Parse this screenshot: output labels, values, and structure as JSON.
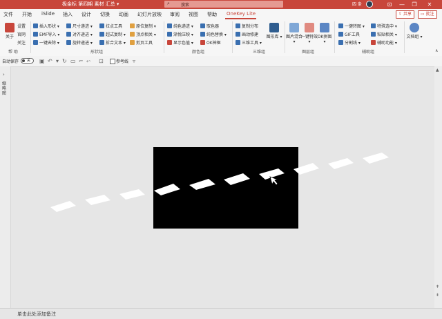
{
  "titlebar": {
    "doc_title": "极金标 第四期 素材 汇总 ▾",
    "search_icon": "search-icon",
    "search_placeholder": "搜索",
    "user_name": "四 条",
    "minimize": "—",
    "restore": "❐",
    "close": "✕",
    "ribbon_toggle": "⊡"
  },
  "tabs": [
    "文件",
    "开始",
    "iSlide",
    "插入",
    "设计",
    "切换",
    "动画",
    "幻灯片放映",
    "审阅",
    "视图",
    "帮助",
    "OneKey Lite"
  ],
  "active_tab": "OneKey Lite",
  "share_label": "共享",
  "comment_label": "批注",
  "ribbon": {
    "group1": {
      "about": "关于",
      "settings": "设置",
      "website": "官网",
      "follow": "关注",
      "label": "帮 助"
    },
    "shape_group": {
      "items": [
        "插入形状 ▾",
        "EMF导入 ▾",
        "一键去除 ▾",
        "尺寸递进 ▾",
        "对齐递进 ▾",
        "旋转递进 ▾",
        "拉点工具",
        "超式复制 ▾",
        "拆合文本 ▾",
        "原位复制 ▾",
        "顶点相关 ▾",
        "剪页工具"
      ],
      "label": "形状组"
    },
    "color_group": {
      "items": [
        "纯色递进 ▾",
        "渐悦压映 ▾",
        "显示色值 ▾",
        "取色器",
        "纯色替换 ▾",
        "OK神框"
      ],
      "label": "颜色组"
    },
    "3d_group": {
      "items": [
        "复制分布",
        "画动修建",
        "三维工具 ▾"
      ],
      "big": "图形库 ▾",
      "label": "三维组"
    },
    "image_group": {
      "bigs": [
        "图片混合 ▾",
        "一键特效 ▾",
        "OK拼图 ▾"
      ],
      "label": "图层组"
    },
    "aux_group": {
      "items": [
        "一键转图 ▾",
        "GIF工具",
        "分割线 ▾",
        "特殊选中 ▾",
        "粘贴相关 ▾",
        "辅助功能 ▾"
      ],
      "label": "辅助组"
    },
    "doc_group": {
      "big": "文档组 ▾"
    },
    "collapse": "∧"
  },
  "qat": {
    "autosave_label": "自动保存",
    "toggle_state": "关",
    "ref_line": "参考线"
  },
  "sidepanel": {
    "label": "缩略图"
  },
  "status": {
    "note_placeholder": "单击此处添加备注"
  },
  "colors": {
    "accent": "#c8463b",
    "slide_bg": "#000000",
    "tile": "#ffffff"
  }
}
